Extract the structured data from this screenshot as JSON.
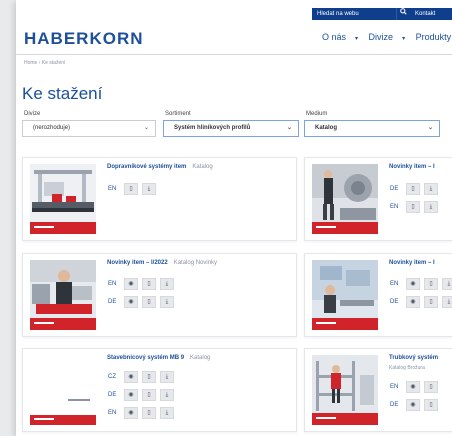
{
  "header": {
    "search_placeholder": "Hledat na webu",
    "search_icon": "search-icon",
    "contact_label": "Kontakt",
    "logo_text": "HABERKORN",
    "nav": [
      "O nás",
      "Divize",
      "Produkty"
    ],
    "nav_chevron": "▾"
  },
  "breadcrumb": "Home › Ke stažení",
  "page_title": "Ke stažení",
  "filters": [
    {
      "label": "Divize",
      "value": "(nerozhoduje)"
    },
    {
      "label": "Sortiment",
      "value": "Systém hliníkových profilů"
    },
    {
      "label": "Medium",
      "value": "Katalog"
    }
  ],
  "cards": [
    {
      "title": "Dopravníkové systémy item",
      "type": "Katalog",
      "subtitle": "",
      "langs": [
        "EN"
      ]
    },
    {
      "title": "Novinky item – I",
      "type": "",
      "subtitle": "",
      "langs": [
        "DE",
        "EN"
      ]
    },
    {
      "title": "Novinky item – I/2022",
      "type": "Katalog Novinky",
      "subtitle": "",
      "langs": [
        "EN",
        "DE"
      ]
    },
    {
      "title": "Novinky item – I",
      "type": "",
      "subtitle": "",
      "langs": [
        "EN",
        "DE"
      ]
    },
    {
      "title": "Stavebnicový systém MB 9",
      "type": "Katalog",
      "subtitle": "",
      "langs": [
        "CZ",
        "DE",
        "EN"
      ]
    },
    {
      "title": "Trubkový systém",
      "type": "",
      "subtitle": "Katalog Brožura",
      "langs": [
        "EN",
        "DE"
      ]
    }
  ],
  "icons": {
    "view": "eye-icon",
    "pdf": "file-icon",
    "download": "download-icon"
  },
  "colors": {
    "brand": "#1d4f9b",
    "topbar": "#0f3e8c",
    "accent_red": "#d1232a"
  }
}
